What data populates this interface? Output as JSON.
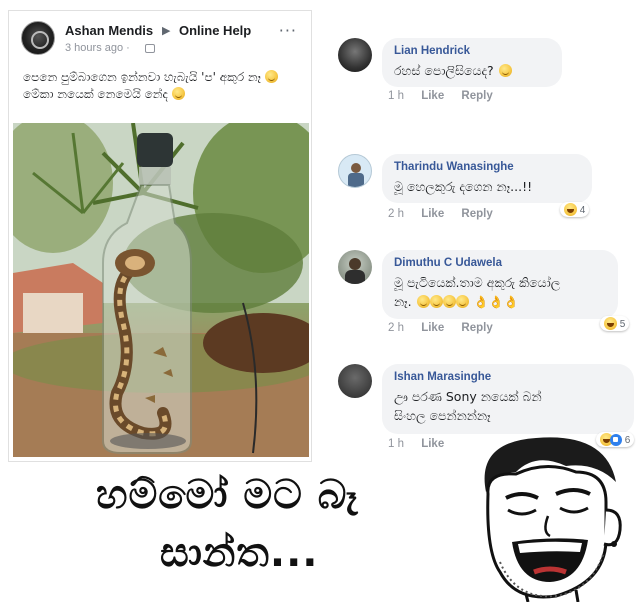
{
  "post": {
    "author": "Ashan Mendis",
    "arrow": "▶",
    "group": "Online Help",
    "time": "3 hours ago ·",
    "menu": "···",
    "text": "පෙනෙ පුම්බාගෙන ඉන්නවා හැබැයි 'ප' අකුර නෑ",
    "text_2": "මේකා නයෙක් නෙමෙයි නේද",
    "image_icon": "cobra-in-bottle-photo"
  },
  "comments": [
    {
      "name": "Lian Hendrick",
      "text": "රහස් පොලිසියෙද?",
      "time": "1 h",
      "like": "Like",
      "reply": "Reply"
    },
    {
      "name": "Tharindu Wanasinghe",
      "text": "මූ හෙලකුරු දගෙන නෑ...!!",
      "time": "2 h",
      "like": "Like",
      "reply": "Reply",
      "reactions": "4"
    },
    {
      "name": "Dimuthu C Udawela",
      "text": "මූ පැටියෙක්.තාම අකුරු කියෝල",
      "text_2": "නෑ.",
      "emojis": "👌👌👌",
      "time": "2 h",
      "like": "Like",
      "reply": "Reply",
      "reactions": "5"
    },
    {
      "name": "Ishan Marasinghe",
      "text": "ඌ පරණ Sony නයෙක් බන්",
      "text_2": "සිංහල පෙන්නන්නෑ",
      "time": "1 h",
      "like": "Like",
      "reactions": "6"
    }
  ],
  "caption": {
    "line_1": "හම්මෝ මට බෑ",
    "line_2": "සාන්ත..."
  },
  "colors": {
    "name_link": "#385898",
    "bubble": "#f2f3f5",
    "meta": "#90949c",
    "like_blue": "#2f80ed"
  }
}
